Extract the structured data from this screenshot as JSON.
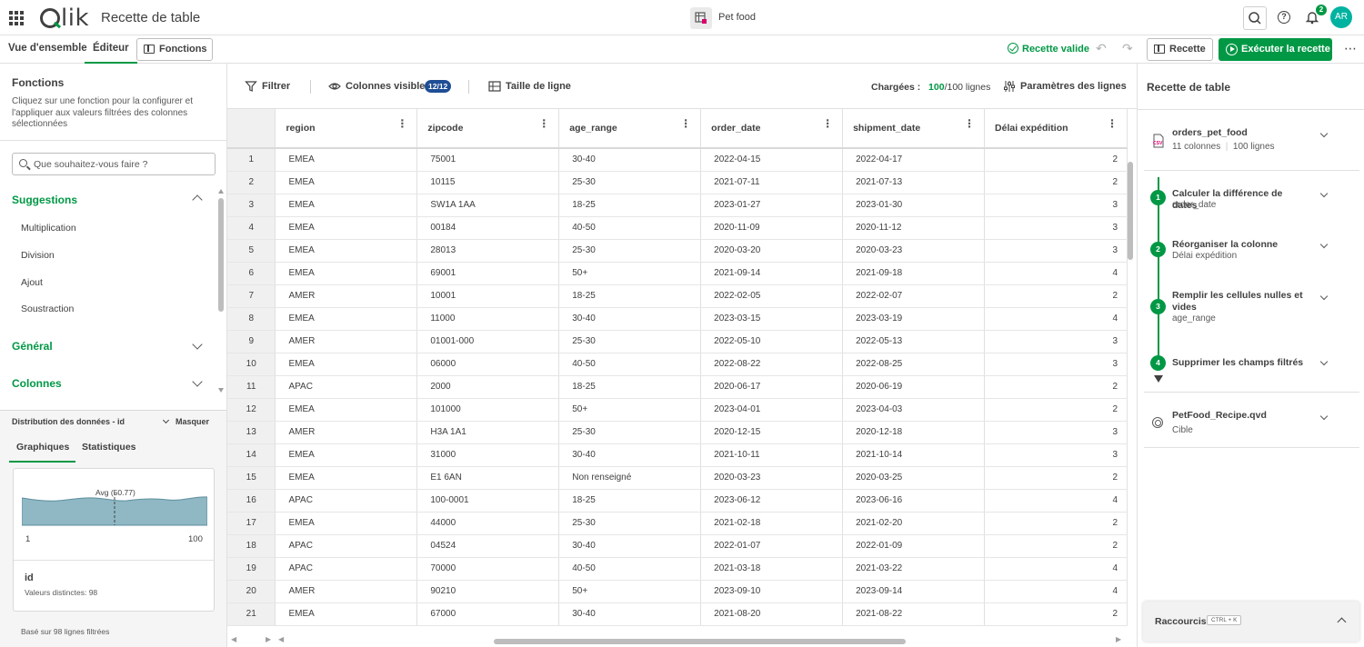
{
  "header": {
    "logo_text": "Qlik",
    "app_title": "Recette de table",
    "space_name": "Pet food",
    "notification_count": "2",
    "avatar_initials": "AR"
  },
  "toolbar": {
    "tab_overview": "Vue d'ensemble",
    "tab_editor": "Éditeur",
    "functions_button": "Fonctions",
    "valid_status": "Recette valide",
    "recipe_button": "Recette",
    "run_button": "Exécuter la recette"
  },
  "functions_panel": {
    "title": "Fonctions",
    "description": "Cliquez sur une fonction pour la configurer et l'appliquer aux valeurs filtrées des colonnes sélectionnées",
    "search_placeholder": "Que souhaitez-vous faire ?",
    "suggestions_label": "Suggestions",
    "suggestions": [
      "Multiplication",
      "Division",
      "Ajout",
      "Soustraction"
    ],
    "general_label": "Général",
    "columns_label": "Colonnes"
  },
  "distribution": {
    "title": "Distribution des données - id",
    "hide_label": "Masquer",
    "tab_charts": "Graphiques",
    "tab_stats": "Statistiques",
    "avg_label": "Avg (50.77)",
    "min_value": "1",
    "max_value": "100",
    "field_name": "id",
    "distinct_label": "Valeurs distinctes: 98",
    "footer": "Basé sur 98 lignes filtrées"
  },
  "data_toolbar": {
    "filter_label": "Filtrer",
    "visible_columns_label": "Colonnes visibles",
    "visible_columns_badge": "12/12",
    "row_height_label": "Taille de ligne",
    "loaded_label": "Chargées :",
    "loaded_count": "100",
    "loaded_total": "/100 lignes",
    "row_params_label": "Paramètres des lignes"
  },
  "table": {
    "columns": [
      "region",
      "zipcode",
      "age_range",
      "order_date",
      "shipment_date",
      "Délai expédition"
    ],
    "rows": [
      [
        "1",
        "EMEA",
        "75001",
        "30-40",
        "2022-04-15",
        "2022-04-17",
        "2"
      ],
      [
        "2",
        "EMEA",
        "10115",
        "25-30",
        "2021-07-11",
        "2021-07-13",
        "2"
      ],
      [
        "3",
        "EMEA",
        "SW1A 1AA",
        "18-25",
        "2023-01-27",
        "2023-01-30",
        "3"
      ],
      [
        "4",
        "EMEA",
        "00184",
        "40-50",
        "2020-11-09",
        "2020-11-12",
        "3"
      ],
      [
        "5",
        "EMEA",
        "28013",
        "25-30",
        "2020-03-20",
        "2020-03-23",
        "3"
      ],
      [
        "6",
        "EMEA",
        "69001",
        "50+",
        "2021-09-14",
        "2021-09-18",
        "4"
      ],
      [
        "7",
        "AMER",
        "10001",
        "18-25",
        "2022-02-05",
        "2022-02-07",
        "2"
      ],
      [
        "8",
        "EMEA",
        "11000",
        "30-40",
        "2023-03-15",
        "2023-03-19",
        "4"
      ],
      [
        "9",
        "AMER",
        "01001-000",
        "25-30",
        "2022-05-10",
        "2022-05-13",
        "3"
      ],
      [
        "10",
        "EMEA",
        "06000",
        "40-50",
        "2022-08-22",
        "2022-08-25",
        "3"
      ],
      [
        "11",
        "APAC",
        "2000",
        "18-25",
        "2020-06-17",
        "2020-06-19",
        "2"
      ],
      [
        "12",
        "EMEA",
        "101000",
        "50+",
        "2023-04-01",
        "2023-04-03",
        "2"
      ],
      [
        "13",
        "AMER",
        "H3A 1A1",
        "25-30",
        "2020-12-15",
        "2020-12-18",
        "3"
      ],
      [
        "14",
        "EMEA",
        "31000",
        "30-40",
        "2021-10-11",
        "2021-10-14",
        "3"
      ],
      [
        "15",
        "EMEA",
        "E1 6AN",
        "Non renseigné",
        "2020-03-23",
        "2020-03-25",
        "2"
      ],
      [
        "16",
        "APAC",
        "100-0001",
        "18-25",
        "2023-06-12",
        "2023-06-16",
        "4"
      ],
      [
        "17",
        "EMEA",
        "44000",
        "25-30",
        "2021-02-18",
        "2021-02-20",
        "2"
      ],
      [
        "18",
        "APAC",
        "04524",
        "30-40",
        "2022-01-07",
        "2022-01-09",
        "2"
      ],
      [
        "19",
        "APAC",
        "70000",
        "40-50",
        "2021-03-18",
        "2021-03-22",
        "4"
      ],
      [
        "20",
        "AMER",
        "90210",
        "50+",
        "2023-09-10",
        "2023-09-14",
        "4"
      ],
      [
        "21",
        "EMEA",
        "67000",
        "30-40",
        "2021-08-20",
        "2021-08-22",
        "2"
      ]
    ]
  },
  "recipe_panel": {
    "title": "Recette de table",
    "source_name": "orders_pet_food",
    "source_format": "CSV",
    "source_columns": "11 colonnes",
    "source_rows": "100 lignes",
    "steps": [
      {
        "number": "1",
        "title": "Calculer la différence de dates",
        "sub": "order_date"
      },
      {
        "number": "2",
        "title": "Réorganiser la colonne",
        "sub": "Délai expédition"
      },
      {
        "number": "3",
        "title": "Remplir les cellules nulles et vides",
        "sub": "age_range"
      },
      {
        "number": "4",
        "title": "Supprimer les champs filtrés",
        "sub": ""
      }
    ],
    "target_name": "PetFood_Recipe.qvd",
    "target_label": "Cible",
    "shortcuts_label": "Raccourcis",
    "shortcuts_key": "CTRL + K"
  },
  "colors": {
    "accent": "#009845",
    "badge": "#1f4e96",
    "avatar": "#00b3a1",
    "chart_fill": "#8fb8c4"
  }
}
